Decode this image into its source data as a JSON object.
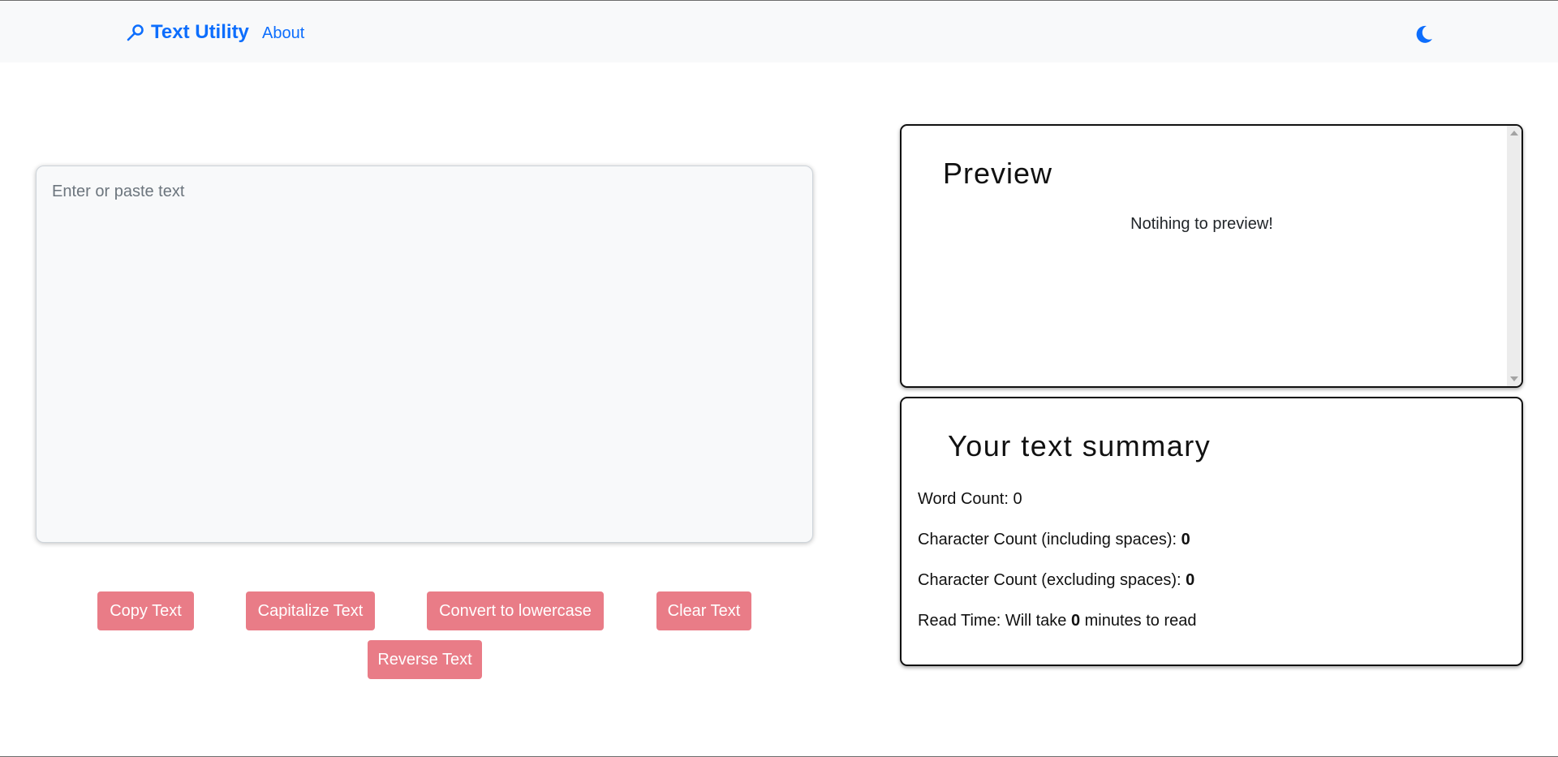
{
  "navbar": {
    "brand": "Text Utility",
    "brand_icon": "magnifier-icon",
    "about": "About",
    "theme_icon": "moon-icon",
    "accent": "#0d6efd"
  },
  "editor": {
    "placeholder": "Enter or paste text",
    "value": ""
  },
  "buttons": {
    "copy": "Copy Text",
    "capitalize": "Capitalize Text",
    "lowercase": "Convert to lowercase",
    "clear": "Clear Text",
    "reverse": "Reverse Text",
    "color": "#e97c87"
  },
  "preview": {
    "title": "Preview",
    "empty_text": "Notihing to preview!"
  },
  "summary": {
    "title": "Your text summary",
    "word_label": "Word Count: ",
    "word_count": "0",
    "char_incl_label": "Character Count (including spaces): ",
    "char_incl_count": "0",
    "char_excl_label": "Character Count (excluding spaces): ",
    "char_excl_count": "0",
    "read_prefix": "Read Time: Will take ",
    "read_minutes": "0",
    "read_suffix": " minutes to read"
  }
}
